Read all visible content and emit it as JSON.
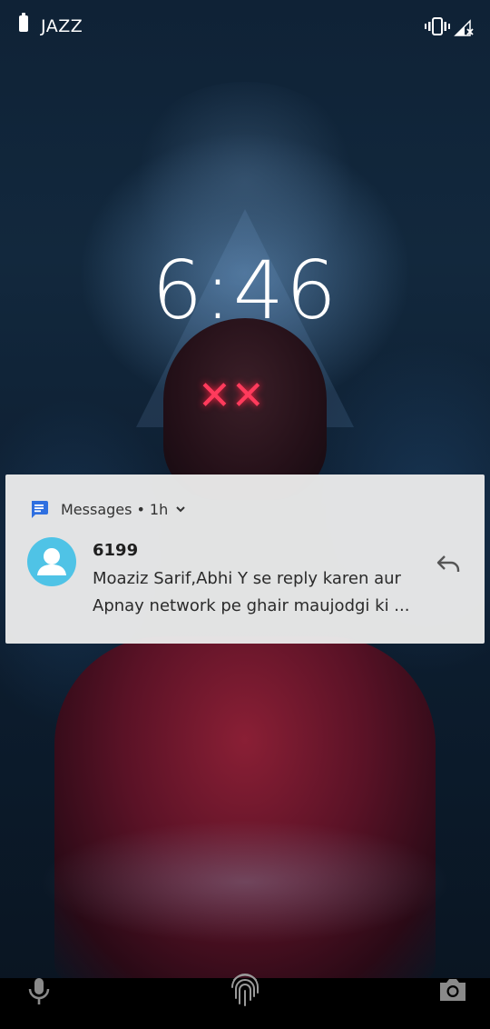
{
  "status_bar": {
    "carrier": "JAZZ",
    "icons": [
      "battery-icon",
      "vibrate-icon",
      "signal-icon"
    ]
  },
  "lockscreen": {
    "time": "6:46"
  },
  "notification": {
    "app_name": "Messages",
    "separator": "•",
    "time_ago": "1h",
    "sender": "6199",
    "message_line1": "Moaziz Sarif,Abhi Y se reply karen aur",
    "message_line2": "Apnay network pe ghair maujodgi ki ...",
    "app_icon_color": "#2e6fe0",
    "avatar_color": "#4fc3e6"
  },
  "bottom_bar": {
    "icons": [
      "microphone-icon",
      "fingerprint-icon",
      "camera-icon"
    ]
  }
}
